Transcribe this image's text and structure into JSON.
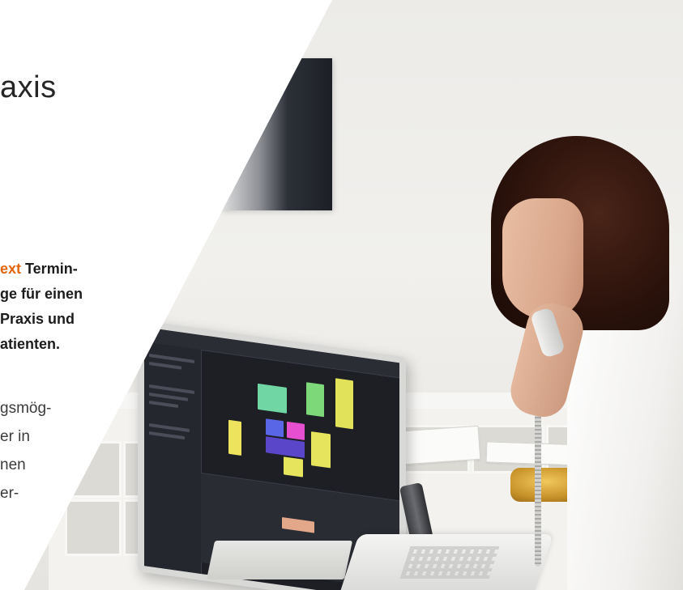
{
  "heading": {
    "text": "axis"
  },
  "lead": {
    "accent": "ext",
    "line1_rest": "  Termin-",
    "line2": "ge für einen",
    "line3": "Praxis  und",
    "line4": "atienten."
  },
  "body_copy": {
    "line1": "gsmög-",
    "line2": "er   in",
    "line3": "nen",
    "line4": "er-"
  },
  "colors": {
    "accent": "#e2660f",
    "heading": "#262626",
    "body": "#3b3b3b"
  }
}
